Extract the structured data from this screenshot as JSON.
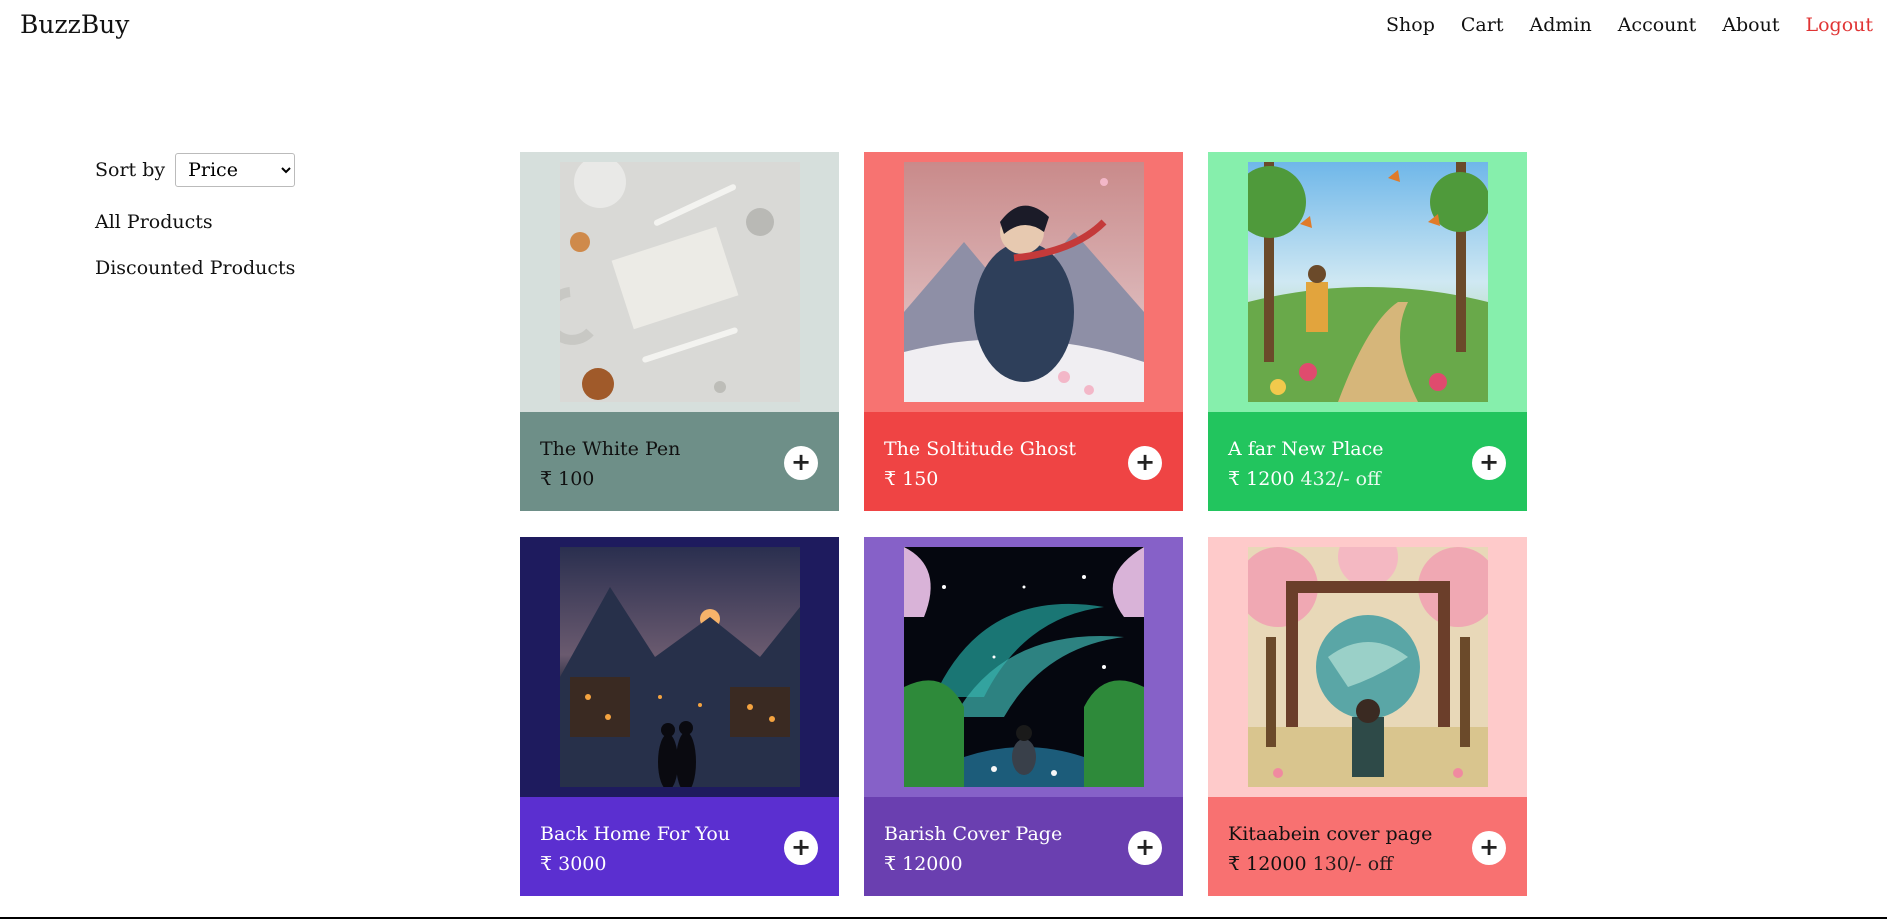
{
  "app": {
    "brand": "BuzzBuy"
  },
  "nav": {
    "items": [
      "Shop",
      "Cart",
      "Admin",
      "Account",
      "About"
    ],
    "logout": "Logout",
    "logout_color": "#e03434"
  },
  "sidebar": {
    "sort_label": "Sort by",
    "sort_selected": "Price",
    "links": [
      "All Products",
      "Discounted Products"
    ]
  },
  "products": [
    {
      "name": "The White Pen",
      "price": "₹ 100",
      "discount": "",
      "bg_top": "#d6dfdc",
      "bg_bottom": "#6e8f88",
      "text_color": "#111111",
      "art": "desk-flatlay"
    },
    {
      "name": "The Soltitude Ghost",
      "price": "₹ 150",
      "discount": "",
      "bg_top": "#f77371",
      "bg_bottom": "#ef4444",
      "text_color": "#ffffff",
      "art": "anime-wanderer"
    },
    {
      "name": "A far New Place",
      "price": "₹ 1200",
      "discount": "432/- off",
      "bg_top": "#86efac",
      "bg_bottom": "#22c55e",
      "text_color": "#ffffff",
      "art": "butterfly-meadow"
    },
    {
      "name": "Back Home For You",
      "price": "₹ 3000",
      "discount": "",
      "bg_top": "#1e1b5e",
      "bg_bottom": "#5b2fd0",
      "text_color": "#ffffff",
      "art": "night-village"
    },
    {
      "name": "Barish Cover Page",
      "price": "₹ 12000",
      "discount": "",
      "bg_top": "#8661c8",
      "bg_bottom": "#6a3fb0",
      "text_color": "#ffffff",
      "art": "starry-forest"
    },
    {
      "name": "Kitaabein cover page",
      "price": "₹ 12000",
      "discount": "130/- off",
      "bg_top": "#fecaca",
      "bg_bottom": "#f87171",
      "text_color": "#111111",
      "art": "frame-blossom"
    }
  ],
  "add_button_symbol": "+"
}
